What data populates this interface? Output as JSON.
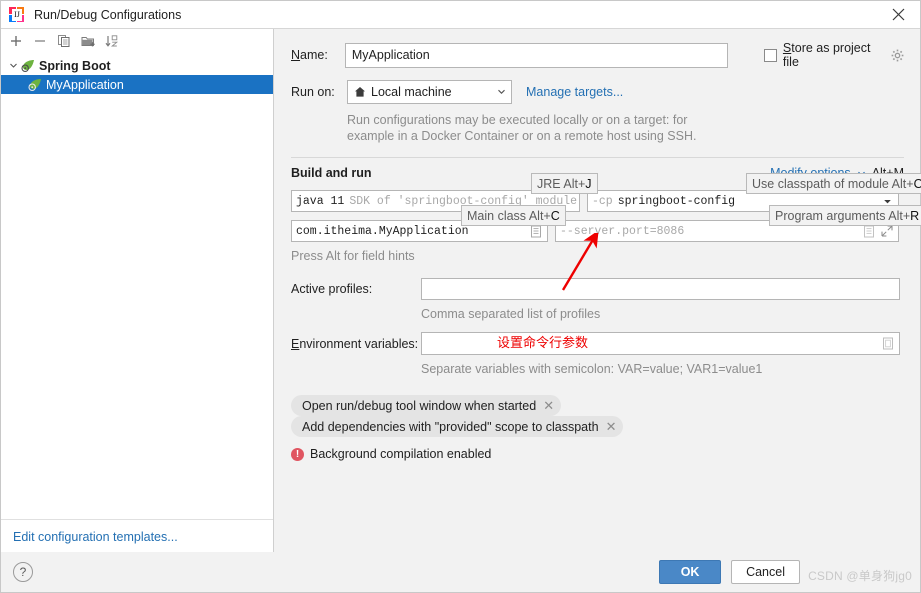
{
  "window": {
    "title": "Run/Debug Configurations",
    "app_icon": "intellij-idea-icon",
    "close_icon": "close-icon"
  },
  "left_panel": {
    "toolbar": [
      {
        "name": "add-configuration-button",
        "icon": "plus-icon",
        "label": "+"
      },
      {
        "name": "remove-configuration-button",
        "icon": "minus-icon",
        "label": "−"
      },
      {
        "name": "copy-configuration-button",
        "icon": "copy-icon",
        "label": "Copy"
      },
      {
        "name": "save-configuration-button",
        "icon": "folder-add-icon",
        "label": "Save"
      },
      {
        "name": "sort-configurations-button",
        "icon": "sort-az-icon",
        "label": "Sort"
      }
    ],
    "tree": [
      {
        "label": "Spring Boot",
        "icon": "spring-boot-icon",
        "expanded": true,
        "selected": false
      },
      {
        "label": "MyApplication",
        "icon": "spring-boot-icon",
        "expanded": false,
        "selected": true
      }
    ],
    "footer_link": "Edit configuration templates..."
  },
  "form": {
    "name_label": "Name:",
    "name_label_mnemonic": "N",
    "name_value": "MyApplication",
    "store_as_project_file_label": "Store as project file",
    "store_as_project_file_checked": false,
    "store_gear_icon": "gear-icon",
    "run_on_label": "Run on:",
    "run_on_value": "Local machine",
    "run_on_icon": "home-icon",
    "manage_targets_link": "Manage targets...",
    "run_on_hint_line1": "Run configurations may be executed locally or on a target: for",
    "run_on_hint_line2": "example in a Docker Container or on a remote host using SSH.",
    "build_and_run_title": "Build and run",
    "modify_options_link": "Modify options",
    "modify_options_shortcut": "Alt+M",
    "jre_value_bold": "java 11",
    "jre_value_grey": "SDK of 'springboot-config' module",
    "classpath_value_grey": "-cp",
    "classpath_value_bold": "springboot-config",
    "main_class_value": "com.itheima.MyApplication",
    "program_args_value_grey": "--server.port=",
    "program_args_value_bold": "8086",
    "program_args_value_full": "--server.port=8086",
    "press_alt_hint": "Press Alt for field hints",
    "active_profiles_label": "Active profiles:",
    "active_profiles_value": "",
    "active_profiles_hint": "Comma separated list of profiles",
    "environment_variables_label": "Environment variables:",
    "environment_variables_mnemonic": "E",
    "environment_variables_value": "",
    "environment_variables_hint": "Separate variables with semicolon: VAR=value; VAR1=value1",
    "browse_icon": "browse-icon",
    "expand_icon": "expand-icon"
  },
  "field_hints": [
    {
      "name": "jre-hint",
      "text": "JRE Alt+",
      "key": "J"
    },
    {
      "name": "main-class-hint",
      "text": "Main class Alt+",
      "key": "C"
    },
    {
      "name": "use-classpath-of-module-hint",
      "text": "Use classpath of module Alt+",
      "key": "O"
    },
    {
      "name": "program-arguments-hint",
      "text": "Program arguments Alt+",
      "key": "R"
    }
  ],
  "chips": [
    {
      "label": "Open run/debug tool window when started",
      "close_icon": "close-icon"
    },
    {
      "label": "Add dependencies with \"provided\" scope to classpath",
      "close_icon": "close-icon"
    }
  ],
  "status": {
    "icon": "error-icon",
    "text": "Background compilation enabled"
  },
  "annotation": {
    "text": "设置命令行参数",
    "color": "#ee0000",
    "arrow_icon": "arrow-up-right-icon"
  },
  "bottom_bar": {
    "help_label": "?",
    "help_icon": "help-icon",
    "ok_label": "OK",
    "cancel_label": "Cancel"
  },
  "watermark": "CSDN @单身狗jg0",
  "colors": {
    "selection": "#1a72c3",
    "link": "#2470b3",
    "primary_button": "#4a88c7",
    "annotation_red": "#ee0000",
    "warning_red": "#e05561",
    "spring_green": "#6db33f",
    "background": "#f2f2f2"
  }
}
